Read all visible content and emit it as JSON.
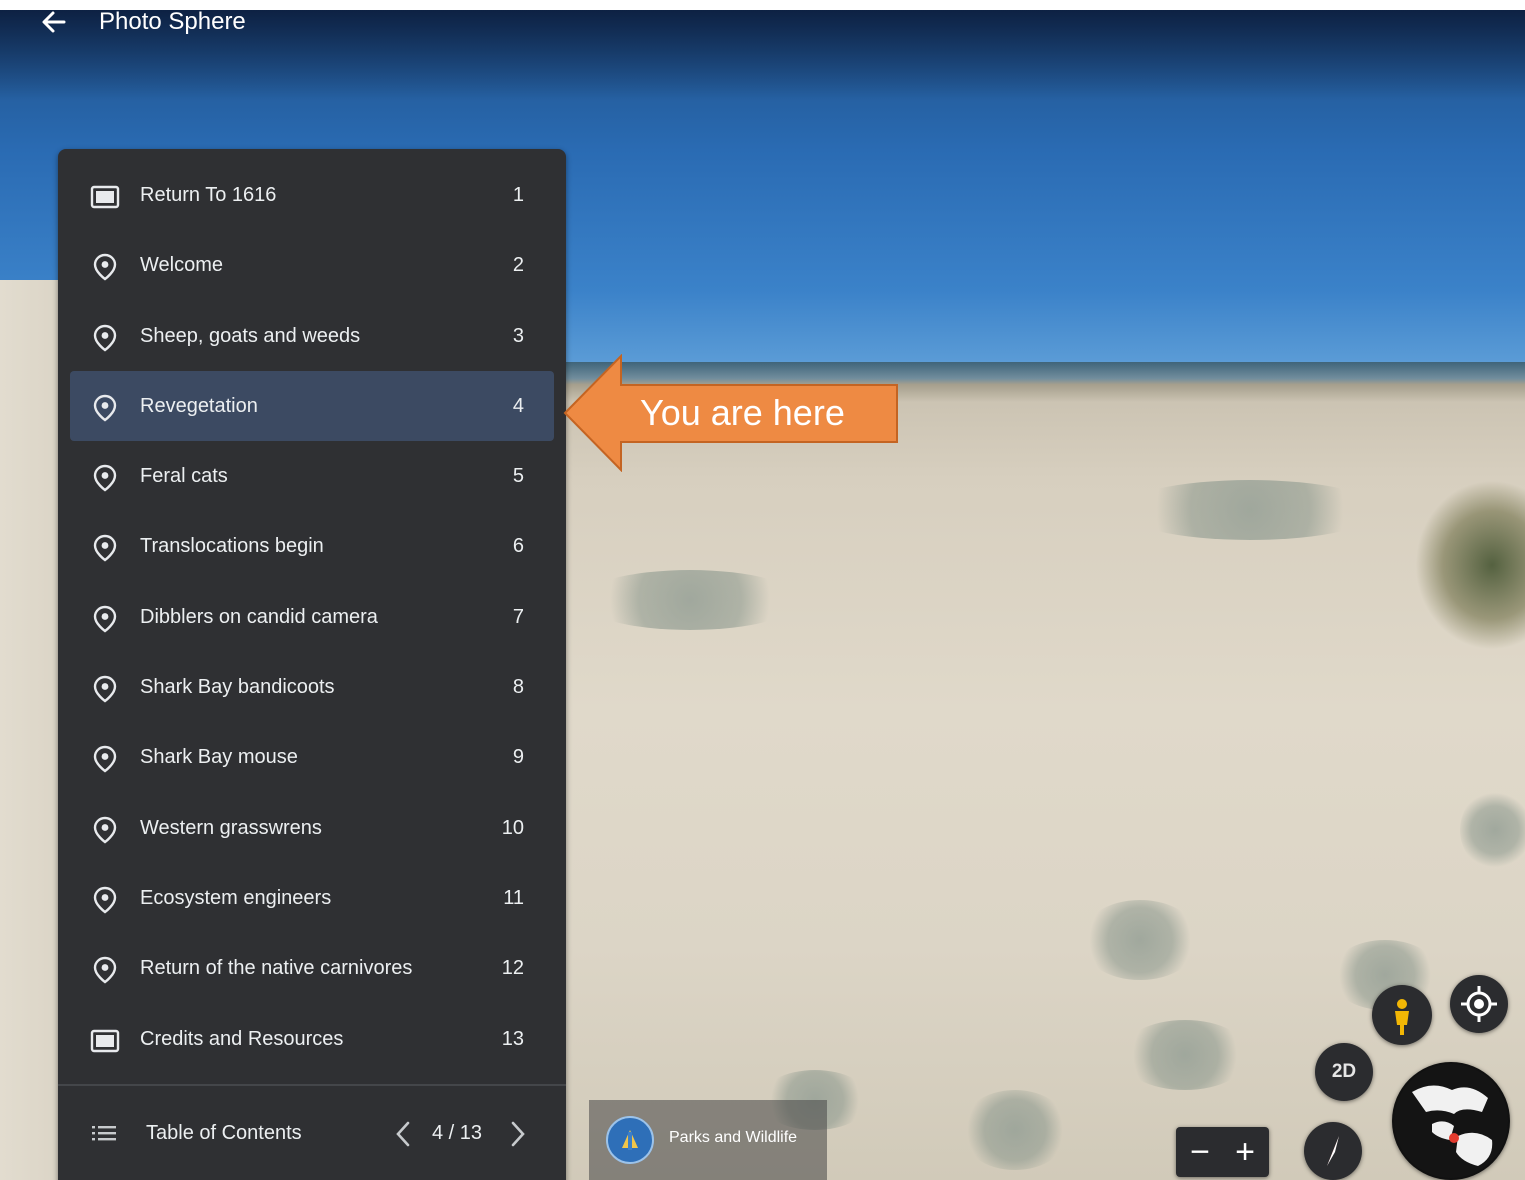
{
  "header": {
    "back_icon": "arrow-left-icon",
    "title": "Photo Sphere"
  },
  "toc": {
    "items": [
      {
        "label": "Return To 1616",
        "number": "1",
        "icon": "slide-icon"
      },
      {
        "label": "Welcome",
        "number": "2",
        "icon": "location-pin-icon"
      },
      {
        "label": "Sheep, goats and weeds",
        "number": "3",
        "icon": "location-pin-icon"
      },
      {
        "label": "Revegetation",
        "number": "4",
        "icon": "location-pin-icon",
        "active": true
      },
      {
        "label": "Feral cats",
        "number": "5",
        "icon": "location-pin-icon"
      },
      {
        "label": "Translocations begin",
        "number": "6",
        "icon": "location-pin-icon"
      },
      {
        "label": "Dibblers on candid camera",
        "number": "7",
        "icon": "location-pin-icon"
      },
      {
        "label": "Shark Bay bandicoots",
        "number": "8",
        "icon": "location-pin-icon"
      },
      {
        "label": "Shark Bay mouse",
        "number": "9",
        "icon": "location-pin-icon"
      },
      {
        "label": "Western grasswrens",
        "number": "10",
        "icon": "location-pin-icon"
      },
      {
        "label": "Ecosystem engineers",
        "number": "11",
        "icon": "location-pin-icon"
      },
      {
        "label": "Return of the native carnivores",
        "number": "12",
        "icon": "location-pin-icon"
      },
      {
        "label": "Credits and Resources",
        "number": "13",
        "icon": "slide-icon"
      }
    ],
    "footer": {
      "label": "Table of Contents",
      "pager": "4 / 13",
      "prev_icon": "chevron-left-icon",
      "next_icon": "chevron-right-icon"
    }
  },
  "callout": {
    "text": "You are here",
    "color": "#ee8a43"
  },
  "attribution": {
    "label": "Parks and Wildlife"
  },
  "controls": {
    "two_d_label": "2D",
    "zoom_minus": "−",
    "zoom_plus": "+"
  },
  "colors": {
    "panel_bg": "#2f3033",
    "active_row": "#3c4a62",
    "pegman": "#f2b705"
  }
}
